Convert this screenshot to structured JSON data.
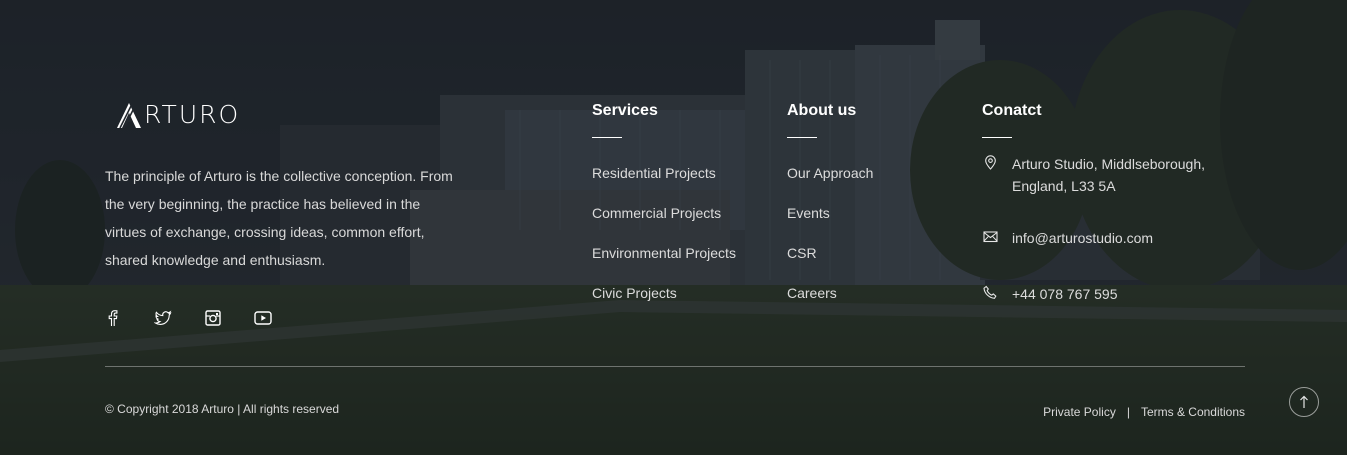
{
  "brand": {
    "logo_text": "RTURO",
    "logo_mark_letter": "A",
    "description": "The principle of Arturo is the collective conception. From the very beginning, the practice has believed in the virtues of exchange, crossing ideas, common effort, shared knowledge and enthusiasm."
  },
  "social": {
    "icons": [
      "facebook-icon",
      "twitter-icon",
      "instagram-icon",
      "youtube-icon"
    ]
  },
  "services": {
    "title": "Services",
    "links": [
      "Residential Projects",
      "Commercial Projects",
      "Environmental Projects",
      "Civic Projects"
    ]
  },
  "about": {
    "title": "About us",
    "links": [
      "Our Approach",
      "Events",
      "CSR",
      "Careers"
    ]
  },
  "contact": {
    "title": "Conatct",
    "address_line1": "Arturo Studio, Middlseborough,",
    "address_line2": "England, L33 5A",
    "email": "info@arturostudio.com",
    "phone": "+44 078 767 595",
    "icons": {
      "address": "map-pin-icon",
      "email": "envelope-icon",
      "phone": "phone-icon"
    }
  },
  "footer": {
    "copyright": "© Copyright 2018 Arturo | All rights reserved",
    "privacy": "Private Policy",
    "separator": "|",
    "terms": "Terms & Conditions",
    "back_to_top_icon": "arrow-up-icon"
  },
  "colors": {
    "overlay": "#12161c",
    "text": "#dcdcdc",
    "heading": "#ffffff"
  }
}
